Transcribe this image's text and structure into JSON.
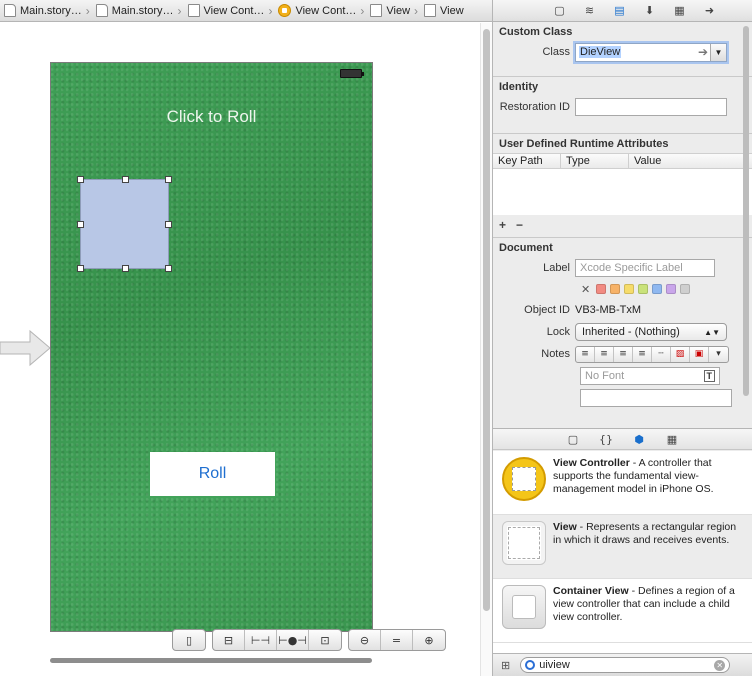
{
  "breadcrumb": [
    {
      "label": "Main.story…",
      "icon": "storyboard-icon"
    },
    {
      "label": "Main.story…",
      "icon": "storyboard-icon"
    },
    {
      "label": "View Cont…",
      "icon": "scene-icon"
    },
    {
      "label": "View Cont…",
      "icon": "view-controller-icon"
    },
    {
      "label": "View",
      "icon": "view-icon"
    },
    {
      "label": "View",
      "icon": "view-icon"
    }
  ],
  "canvas": {
    "click_label": "Click to Roll",
    "roll_button": "Roll",
    "controls": [
      "▯",
      "⊟",
      "⊢⊣",
      "⊢●⊣",
      "⊡",
      "⊖",
      "=",
      "⊕"
    ]
  },
  "inspector": {
    "custom_class": {
      "title": "Custom Class",
      "class_label": "Class",
      "class_value": "DieView"
    },
    "identity": {
      "title": "Identity",
      "restoration_label": "Restoration ID",
      "restoration_value": ""
    },
    "udra": {
      "title": "User Defined Runtime Attributes",
      "columns": [
        "Key Path",
        "Type",
        "Value"
      ],
      "add": "+",
      "remove": "−"
    },
    "document": {
      "title": "Document",
      "label_label": "Label",
      "label_placeholder": "Xcode Specific Label",
      "object_id_label": "Object ID",
      "object_id_value": "VB3-MB-TxM",
      "lock_label": "Lock",
      "lock_value": "Inherited - (Nothing)",
      "notes_label": "Notes",
      "font_placeholder": "No Font",
      "swatch_colors": [
        "#f28b82",
        "#f7b267",
        "#f6dc6b",
        "#c9e27a",
        "#8fb8f0",
        "#c9a6ea",
        "#cfcfcf"
      ]
    }
  },
  "library": {
    "items": [
      {
        "name": "View Controller",
        "desc": " - A controller that supports the fundamental view-management model in iPhone OS."
      },
      {
        "name": "View",
        "desc": " - Represents a rectangular region in which it draws and receives events."
      },
      {
        "name": "Container View",
        "desc": " - Defines a region of a view controller that can include a child view controller."
      }
    ],
    "search_value": "uiview"
  }
}
